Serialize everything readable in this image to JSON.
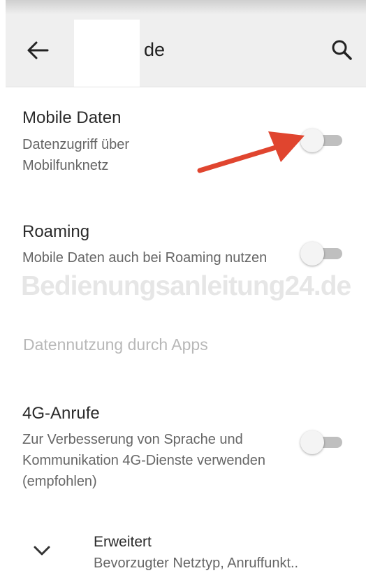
{
  "app_bar": {
    "title": "de",
    "back_icon": "arrow-left-icon",
    "search_icon": "search-icon"
  },
  "settings": {
    "mobile_data": {
      "title": "Mobile Daten",
      "subtitle": "Datenzugriff über Mobilfunknetz",
      "enabled": false
    },
    "roaming": {
      "title": "Roaming",
      "subtitle": "Mobile Daten auch bei Roaming nutzen",
      "enabled": false
    },
    "app_usage": {
      "title": "Datennutzung durch Apps"
    },
    "volte": {
      "title": "4G-Anrufe",
      "subtitle": "Zur Verbesserung von Sprache und Kommunikation 4G-Dienste verwenden (empfohlen)",
      "enabled": false
    },
    "advanced": {
      "title": "Erweitert",
      "subtitle": "Bevorzugter Netztyp, Anruffunkt..",
      "icon": "chevron-down-icon"
    }
  },
  "watermark": "Bedienungsanleitung24.de",
  "colors": {
    "annotation_arrow": "#e0452f",
    "appbar_bg": "#efefef",
    "switch_off_track": "#bfbfbf",
    "disabled_text": "#b8b8b8"
  }
}
